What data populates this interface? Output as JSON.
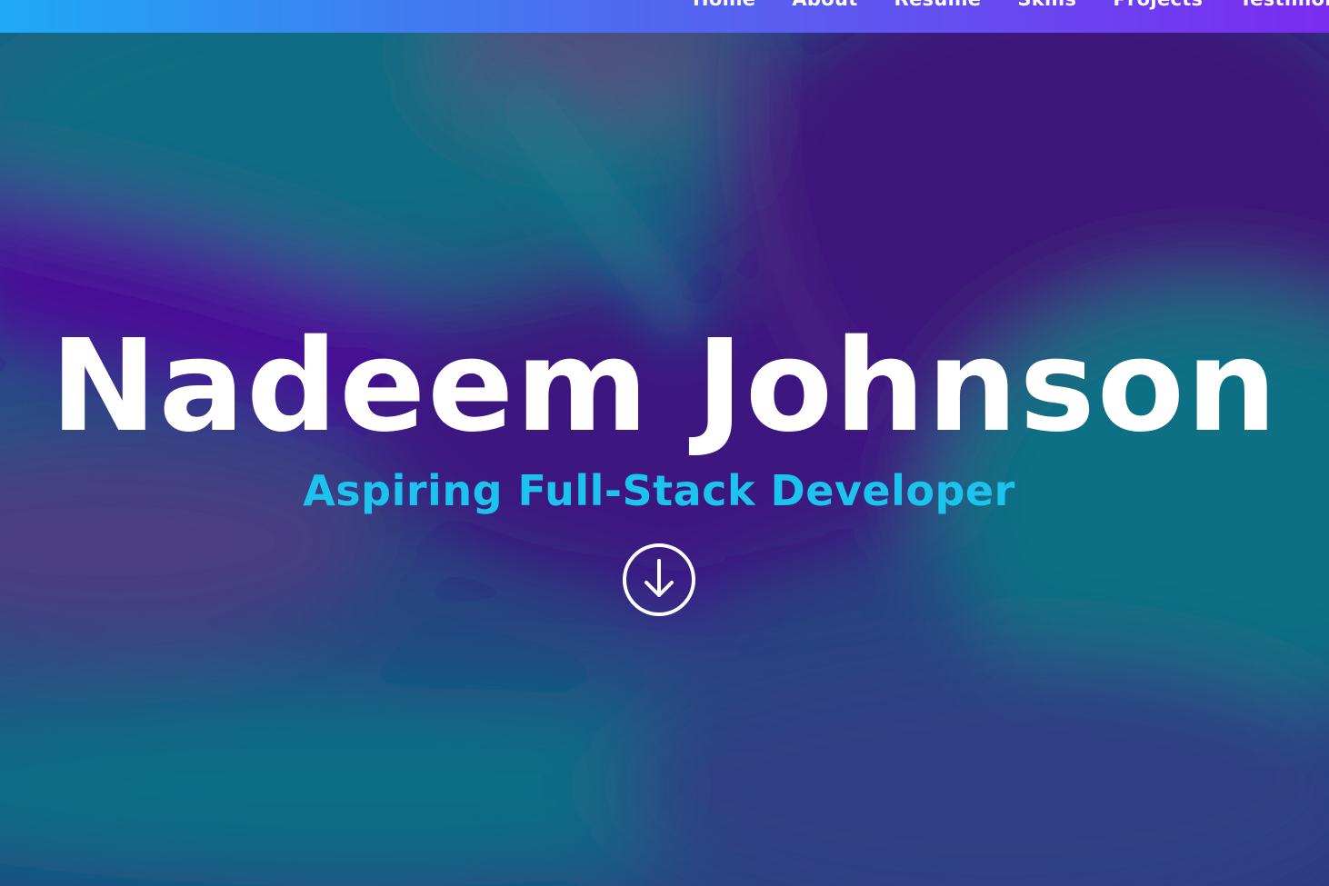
{
  "nav": {
    "items": [
      {
        "label": "Home"
      },
      {
        "label": "About"
      },
      {
        "label": "Resume"
      },
      {
        "label": "Skills"
      },
      {
        "label": "Projects"
      },
      {
        "label": "Testimonials"
      }
    ]
  },
  "hero": {
    "name": "Nadeem Johnson",
    "tagline": "Aspiring Full-Stack Developer",
    "scroll_icon": "arrow-down-circle-icon"
  },
  "colors": {
    "nav_gradient_start": "#1eaaf5",
    "nav_gradient_end": "#7a2cf0",
    "title": "#ffffff",
    "tagline": "#1cc3ec",
    "bg_teal": "#0e6f82",
    "bg_purple": "#3f167a"
  }
}
